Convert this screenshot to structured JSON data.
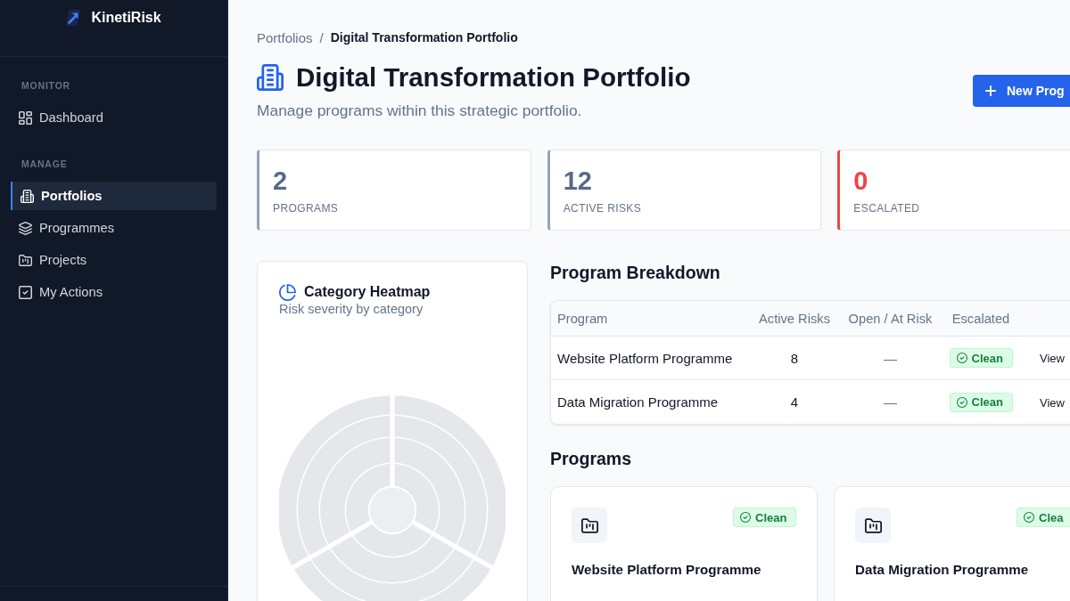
{
  "sidebar": {
    "brand": "KinetiRisk",
    "sections": [
      {
        "label": "MONITOR",
        "items": [
          {
            "label": "Dashboard",
            "selected": false
          }
        ]
      },
      {
        "label": "MANAGE",
        "items": [
          {
            "label": "Portfolios",
            "selected": true
          },
          {
            "label": "Programmes",
            "selected": false
          },
          {
            "label": "Projects",
            "selected": false
          },
          {
            "label": "My Actions",
            "selected": false
          }
        ]
      }
    ]
  },
  "breadcrumb": {
    "items": [
      {
        "label": "Portfolios",
        "current": false
      },
      {
        "label": "Digital Transformation Portfolio",
        "current": true
      }
    ],
    "separator": "/"
  },
  "header": {
    "title": "Digital Transformation Portfolio",
    "subtitle": "Manage programs within this strategic portfolio.",
    "button": "New Prog"
  },
  "stats": [
    {
      "value": "2",
      "label": "PROGRAMS",
      "kind": "neutral"
    },
    {
      "value": "12",
      "label": "ACTIVE RISKS",
      "kind": "neutral"
    },
    {
      "value": "0",
      "label": "ESCALATED",
      "kind": "danger"
    }
  ],
  "heatmap": {
    "title": "Category Heatmap",
    "subtitle": "Risk severity by category"
  },
  "breakdown": {
    "title": "Program Breakdown",
    "columns": [
      "Program",
      "Active Risks",
      "Open / At Risk",
      "Escalated"
    ],
    "rows": [
      {
        "program": "Website Platform Programme",
        "active_risks": "8",
        "open_at_risk": "—",
        "escalated": {
          "label": "Clean",
          "kind": "clean"
        },
        "action": "View"
      },
      {
        "program": "Data Migration Programme",
        "active_risks": "4",
        "open_at_risk": "—",
        "escalated": {
          "label": "Clean",
          "kind": "clean"
        },
        "action": "View"
      }
    ]
  },
  "programs": {
    "title": "Programs",
    "cards": [
      {
        "name": "Website Platform Programme",
        "status": {
          "label": "Clean",
          "kind": "clean"
        }
      },
      {
        "name": "Data Migration Programme",
        "status": {
          "label": "Clea",
          "kind": "clean"
        }
      }
    ]
  }
}
